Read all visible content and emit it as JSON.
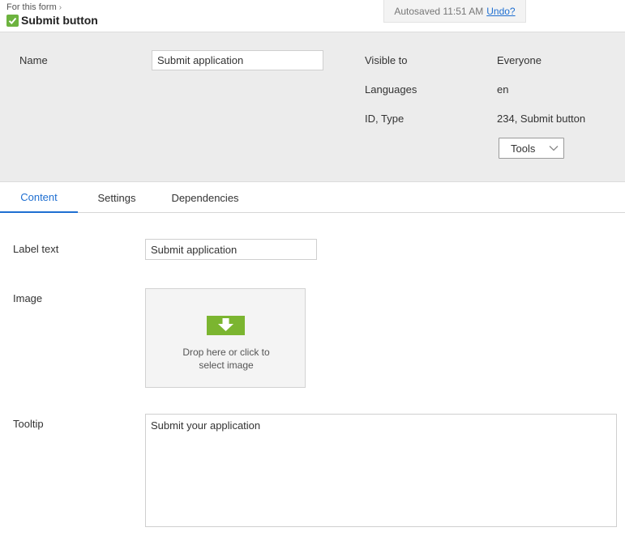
{
  "header": {
    "breadcrumb": "For this form",
    "title": "Submit button",
    "autosave_text": "Autosaved 11:51 AM",
    "undo_label": "Undo?"
  },
  "properties": {
    "name_label": "Name",
    "name_value": "Submit application",
    "visible_to_label": "Visible to",
    "visible_to_value": "Everyone",
    "languages_label": "Languages",
    "languages_value": "en",
    "id_type_label": "ID, Type",
    "id_type_value": "234, Submit button",
    "tools_label": "Tools"
  },
  "tabs": [
    {
      "label": "Content",
      "active": true
    },
    {
      "label": "Settings",
      "active": false
    },
    {
      "label": "Dependencies",
      "active": false
    }
  ],
  "content": {
    "label_text_label": "Label text",
    "label_text_value": "Submit application",
    "image_label": "Image",
    "dropzone_line1": "Drop here or click to",
    "dropzone_line2": "select image",
    "tooltip_label": "Tooltip",
    "tooltip_value": "Submit your application"
  },
  "colors": {
    "accent": "#1f6fd1",
    "success": "#6db33f",
    "drop_icon": "#7bb530"
  }
}
